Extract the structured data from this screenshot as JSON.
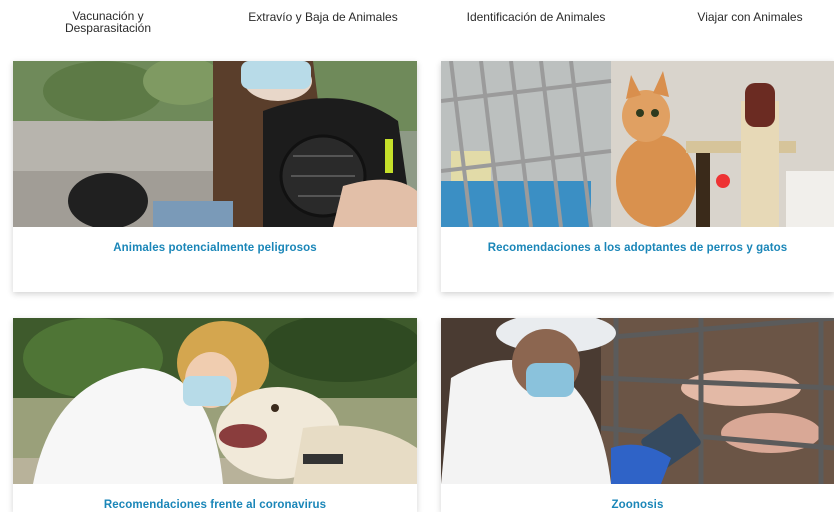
{
  "nav": {
    "items": [
      {
        "label": "Vacunación y Desparasitación"
      },
      {
        "label": "Extravío y Baja de Animales"
      },
      {
        "label": "Identificación de Animales"
      },
      {
        "label": "Viajar con Animales"
      }
    ]
  },
  "cards": [
    {
      "title": "Animales potencialmente peligrosos",
      "image": "woman-with-muzzled-dog-photo"
    },
    {
      "title": "Recomendaciones a los adoptantes de perros y gatos",
      "image": "cat-in-shelter-cage-photo"
    },
    {
      "title": "Recomendaciones frente al coronavirus",
      "image": "masked-woman-hugging-dog-photo"
    },
    {
      "title": "Zoonosis",
      "image": "masked-vet-with-pigs-photo"
    }
  ],
  "colors": {
    "card_title": "#1a86b8",
    "nav_text": "#2b2b2b"
  }
}
